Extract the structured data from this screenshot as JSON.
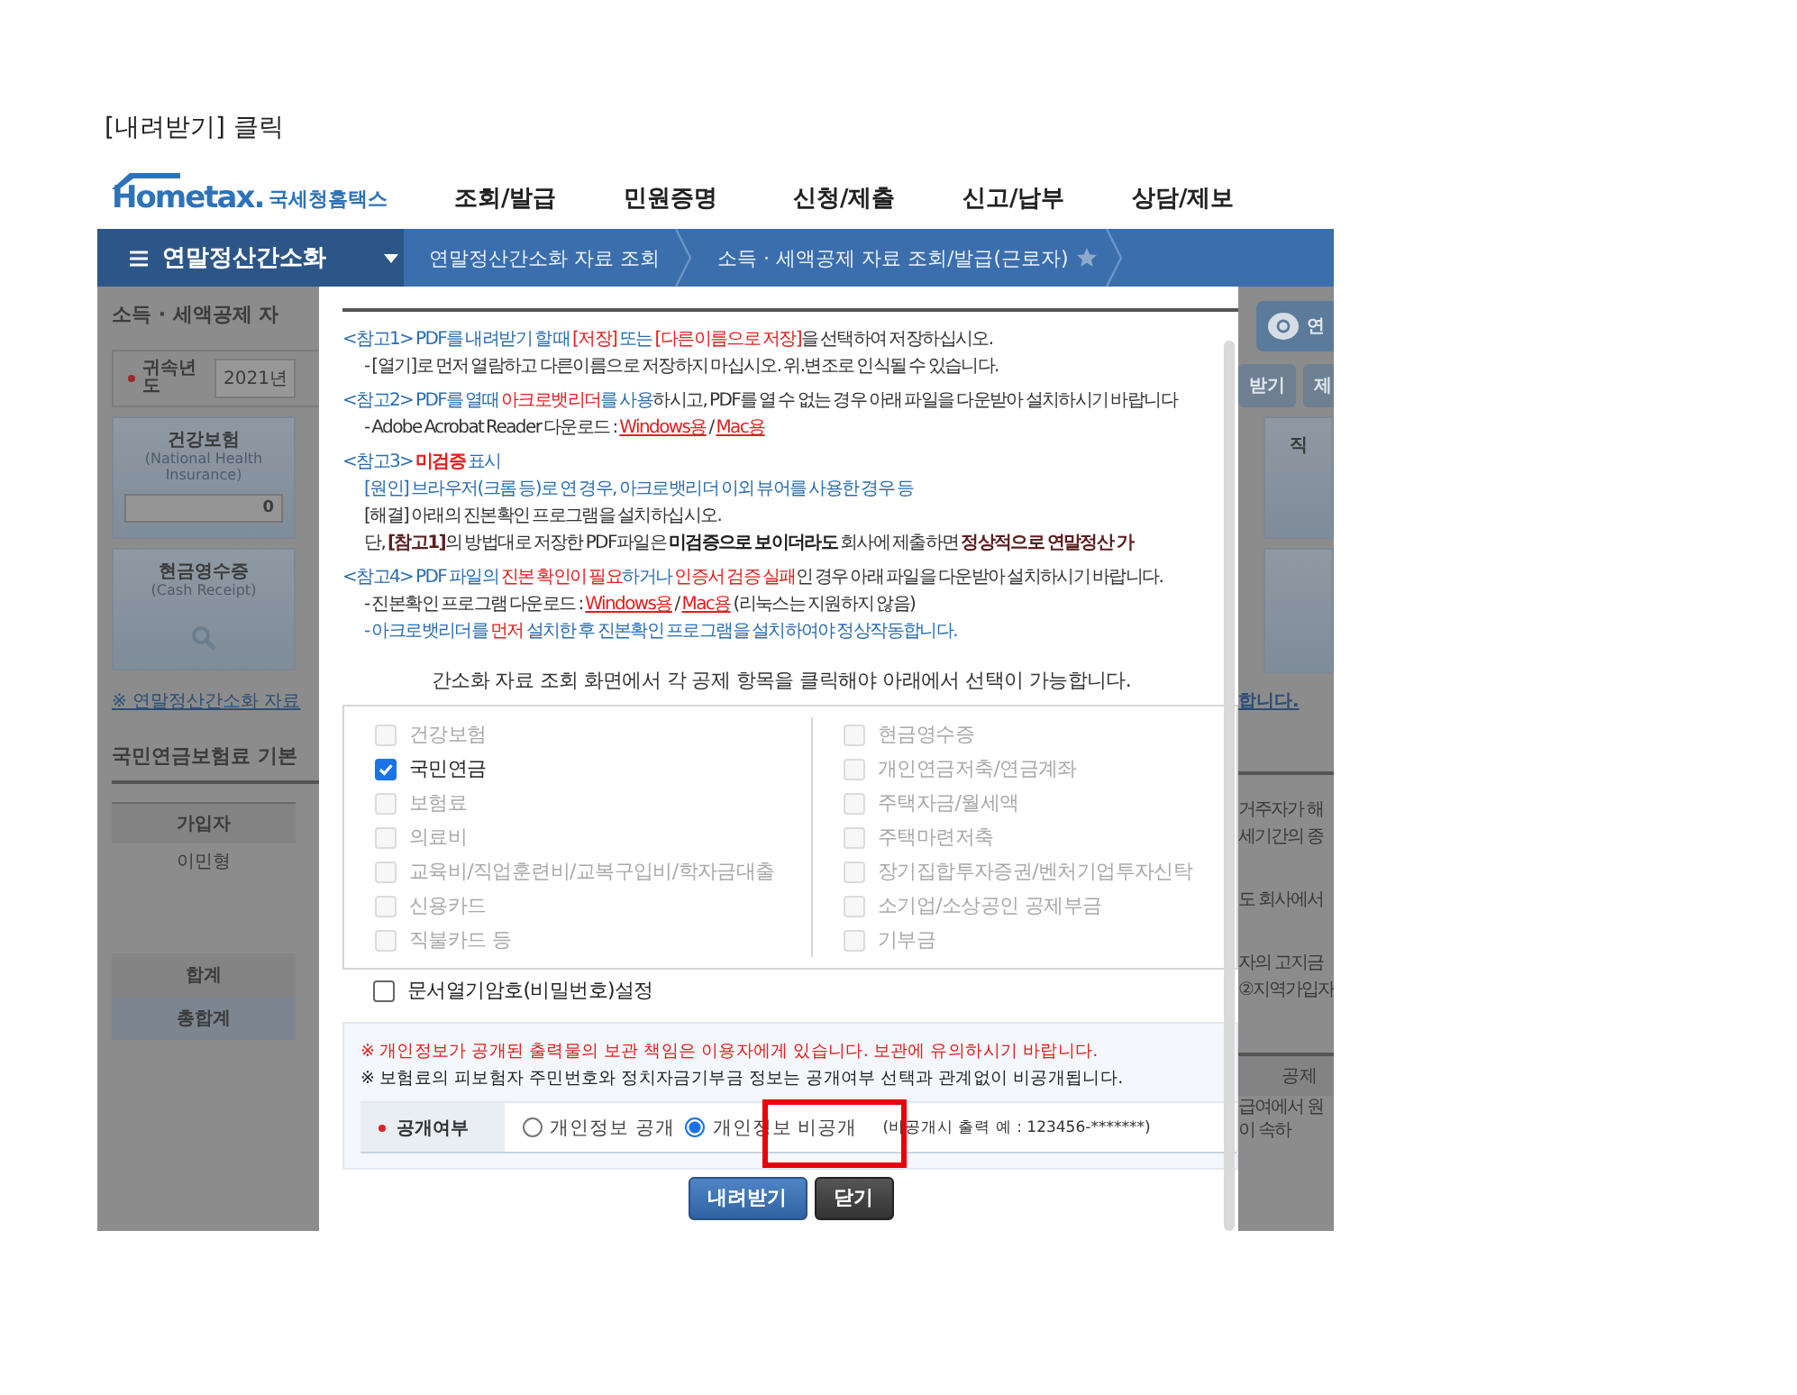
{
  "caption": "[내려받기] 클릭",
  "header": {
    "logo": "Hometax.",
    "logo_sub": "국세청홈택스",
    "nav": [
      "조회/발급",
      "민원증명",
      "신청/제출",
      "신고/납부",
      "상담/제보"
    ]
  },
  "menu_bar": {
    "menu": "연말정산간소화",
    "breadcrumbs": [
      "연말정산간소화 자료 조회",
      "소득 · 세액공제 자료 조회/발급(근로자)"
    ]
  },
  "background_left": {
    "title": "소득 · 세액공제 자",
    "year_label": "귀속년도",
    "year_value": "2021년",
    "cards": [
      {
        "title": "건강보험",
        "subtitle": "(National Health Insurance)",
        "value": "0"
      },
      {
        "title": "현금영수증",
        "subtitle": "(Cash Receipt)"
      }
    ],
    "link": "※ 연말정산간소화 자료",
    "section_title": "국민연금보험료 기본",
    "table_header": "가입자",
    "member": "이민형",
    "subtotal": "합계",
    "total": "총합계"
  },
  "background_right": {
    "top_button": "연",
    "buttons": [
      "받기",
      "제"
    ],
    "card_title": "직",
    "link": "합니다.",
    "texts": [
      {
        "kind": "line",
        "text": "거주자가 해"
      },
      {
        "kind": "line",
        "text": "세기간의 종"
      },
      {
        "kind": "gap"
      },
      {
        "kind": "line",
        "text": "도 회사에서"
      },
      {
        "kind": "gap"
      },
      {
        "kind": "line",
        "text": "자의 고지금"
      },
      {
        "kind": "line",
        "text": "②지역가입자"
      }
    ],
    "table_header": "공제",
    "cells": [
      "급여에서 원",
      "이 속하"
    ]
  },
  "modal": {
    "notes": [
      [
        {
          "text": "<참고1> PDF를 내려받기 할 때 ",
          "color": "#2a6db0"
        },
        {
          "text": "[저장]",
          "color": "#e02020"
        },
        {
          "text": " 또는 ",
          "color": "#2a6db0"
        },
        {
          "text": "[다른이름으로 저장]",
          "color": "#e02020"
        },
        {
          "text": "을 선택하여 저장하십시오.",
          "color": "#333333"
        }
      ],
      [
        {
          "text": "- [열기]로 먼저 열람하고 다른이름으로 저장하지 마십시오. 위.변조로 인식될 수 있습니다.",
          "color": "#333333",
          "indent": true
        }
      ],
      [
        {
          "text": "<참고2> PDF를 열때 ",
          "color": "#2a6db0"
        },
        {
          "text": "아크로뱃리더",
          "color": "#e02020"
        },
        {
          "text": "를 사용",
          "color": "#2a6db0"
        },
        {
          "text": "하시고, PDF를 열 수 없는 경우 아래 파일을 다운받아 설치하시기 바랍니다",
          "color": "#333333"
        }
      ],
      [
        {
          "text": "- Adobe Acrobat Reader 다운로드 : ",
          "color": "#333333",
          "indent": true
        },
        {
          "text": "Windows용",
          "kind": "link"
        },
        {
          "text": " / ",
          "color": "#333333"
        },
        {
          "text": "Mac용",
          "kind": "link"
        }
      ],
      [
        {
          "text": "<참고3> ",
          "color": "#2a6db0"
        },
        {
          "text": "미검증",
          "color": "#e02020",
          "bold": true
        },
        {
          "text": " 표시",
          "color": "#2a6db0"
        }
      ],
      [
        {
          "text": "[원인] 브라우저(크롬 등)로 연 경우, 아크로뱃리더 이외 뷰어를 사용한 경우 등",
          "color": "#2a6db0",
          "indent": true
        }
      ],
      [
        {
          "text": "[해결] 아래의 진본확인 프로그램을 설치하십시오.",
          "color": "#333333",
          "indent": true
        }
      ],
      [
        {
          "text": "단, ",
          "color": "#333333",
          "indent": true
        },
        {
          "text": "[참고1]",
          "color": "#5a2020",
          "bold": true
        },
        {
          "text": "의 방법대로 저장한 PDF파일은 ",
          "color": "#333333"
        },
        {
          "text": "미검증으로 보이더라도",
          "color": "#222222",
          "bold": true
        },
        {
          "text": " 회사에 제출하면 ",
          "color": "#333333"
        },
        {
          "text": "정상적으로 연말정산 가",
          "color": "#5a2020",
          "bold": true
        }
      ],
      [
        {
          "text": "<참고4> PDF 파일의 ",
          "color": "#2a6db0"
        },
        {
          "text": "진본 확인이 필요",
          "color": "#e02020"
        },
        {
          "text": "하거나 ",
          "color": "#2a6db0"
        },
        {
          "text": "인증서 검증 실패",
          "color": "#e02020"
        },
        {
          "text": "인 경우 아래 파일을 다운받아 설치하시기 바랍니다.",
          "color": "#333333"
        }
      ],
      [
        {
          "text": "- 진본확인 프로그램 다운로드 : ",
          "color": "#333333",
          "indent": true
        },
        {
          "text": "Windows용",
          "kind": "link"
        },
        {
          "text": " / ",
          "color": "#333333"
        },
        {
          "text": "Mac용",
          "kind": "link"
        },
        {
          "text": " (리눅스는 지원하지 않음)",
          "color": "#333333"
        }
      ],
      [
        {
          "text": "- 아크로뱃리더를 ",
          "color": "#2a6db0",
          "indent": true
        },
        {
          "text": "먼저",
          "color": "#e02020"
        },
        {
          "text": " 설치한 후 진본확인 프로그램을 설치하여야 정상작동합니다.",
          "color": "#2a6db0"
        }
      ]
    ],
    "instruction": "간소화 자료 조회 화면에서 각 공제 항목을 클릭해야 아래에서 선택이 가능합니다.",
    "columns": [
      [
        {
          "label": "건강보험",
          "checked": false,
          "disabled": true
        },
        {
          "label": "국민연금",
          "checked": true,
          "disabled": false
        },
        {
          "label": "보험료",
          "checked": false,
          "disabled": true
        },
        {
          "label": "의료비",
          "checked": false,
          "disabled": true
        },
        {
          "label": "교육비/직업훈련비/교복구입비/학자금대출",
          "checked": false,
          "disabled": true
        },
        {
          "label": "신용카드",
          "checked": false,
          "disabled": true
        },
        {
          "label": "직불카드 등",
          "checked": false,
          "disabled": true
        }
      ],
      [
        {
          "label": "현금영수증",
          "checked": false,
          "disabled": true
        },
        {
          "label": "개인연금저축/연금계좌",
          "checked": false,
          "disabled": true
        },
        {
          "label": "주택자금/월세액",
          "checked": false,
          "disabled": true
        },
        {
          "label": "주택마련저축",
          "checked": false,
          "disabled": true
        },
        {
          "label": "장기집합투자증권/벤처기업투자신탁",
          "checked": false,
          "disabled": true
        },
        {
          "label": "소기업/소상공인 공제부금",
          "checked": false,
          "disabled": true
        },
        {
          "label": "기부금",
          "checked": false,
          "disabled": true
        }
      ]
    ],
    "password": {
      "label": "문서열기암호(비밀번호)설정",
      "checked": false
    },
    "warning": "※ 개인정보가 공개된 출력물의 보관 책임은 이용자에게 있습니다. 보관에 유의하시기 바랍니다.",
    "info": "※ 보험료의 피보험자 주민번호와 정치자금기부금 정보는 공개여부 선택과 관계없이 비공개됩니다.",
    "disclosure": {
      "label": "공개여부",
      "required": true,
      "options": [
        {
          "label": "개인정보 공개",
          "selected": false,
          "highlighted": false
        },
        {
          "label": "개인정보 비공개",
          "selected": true,
          "highlighted": true
        }
      ],
      "hint": "(비공개시 출력 예 : 123456-*******)"
    },
    "buttons": [
      {
        "label": "내려받기",
        "kind": "primary"
      },
      {
        "label": "닫기",
        "kind": "secondary"
      }
    ]
  }
}
